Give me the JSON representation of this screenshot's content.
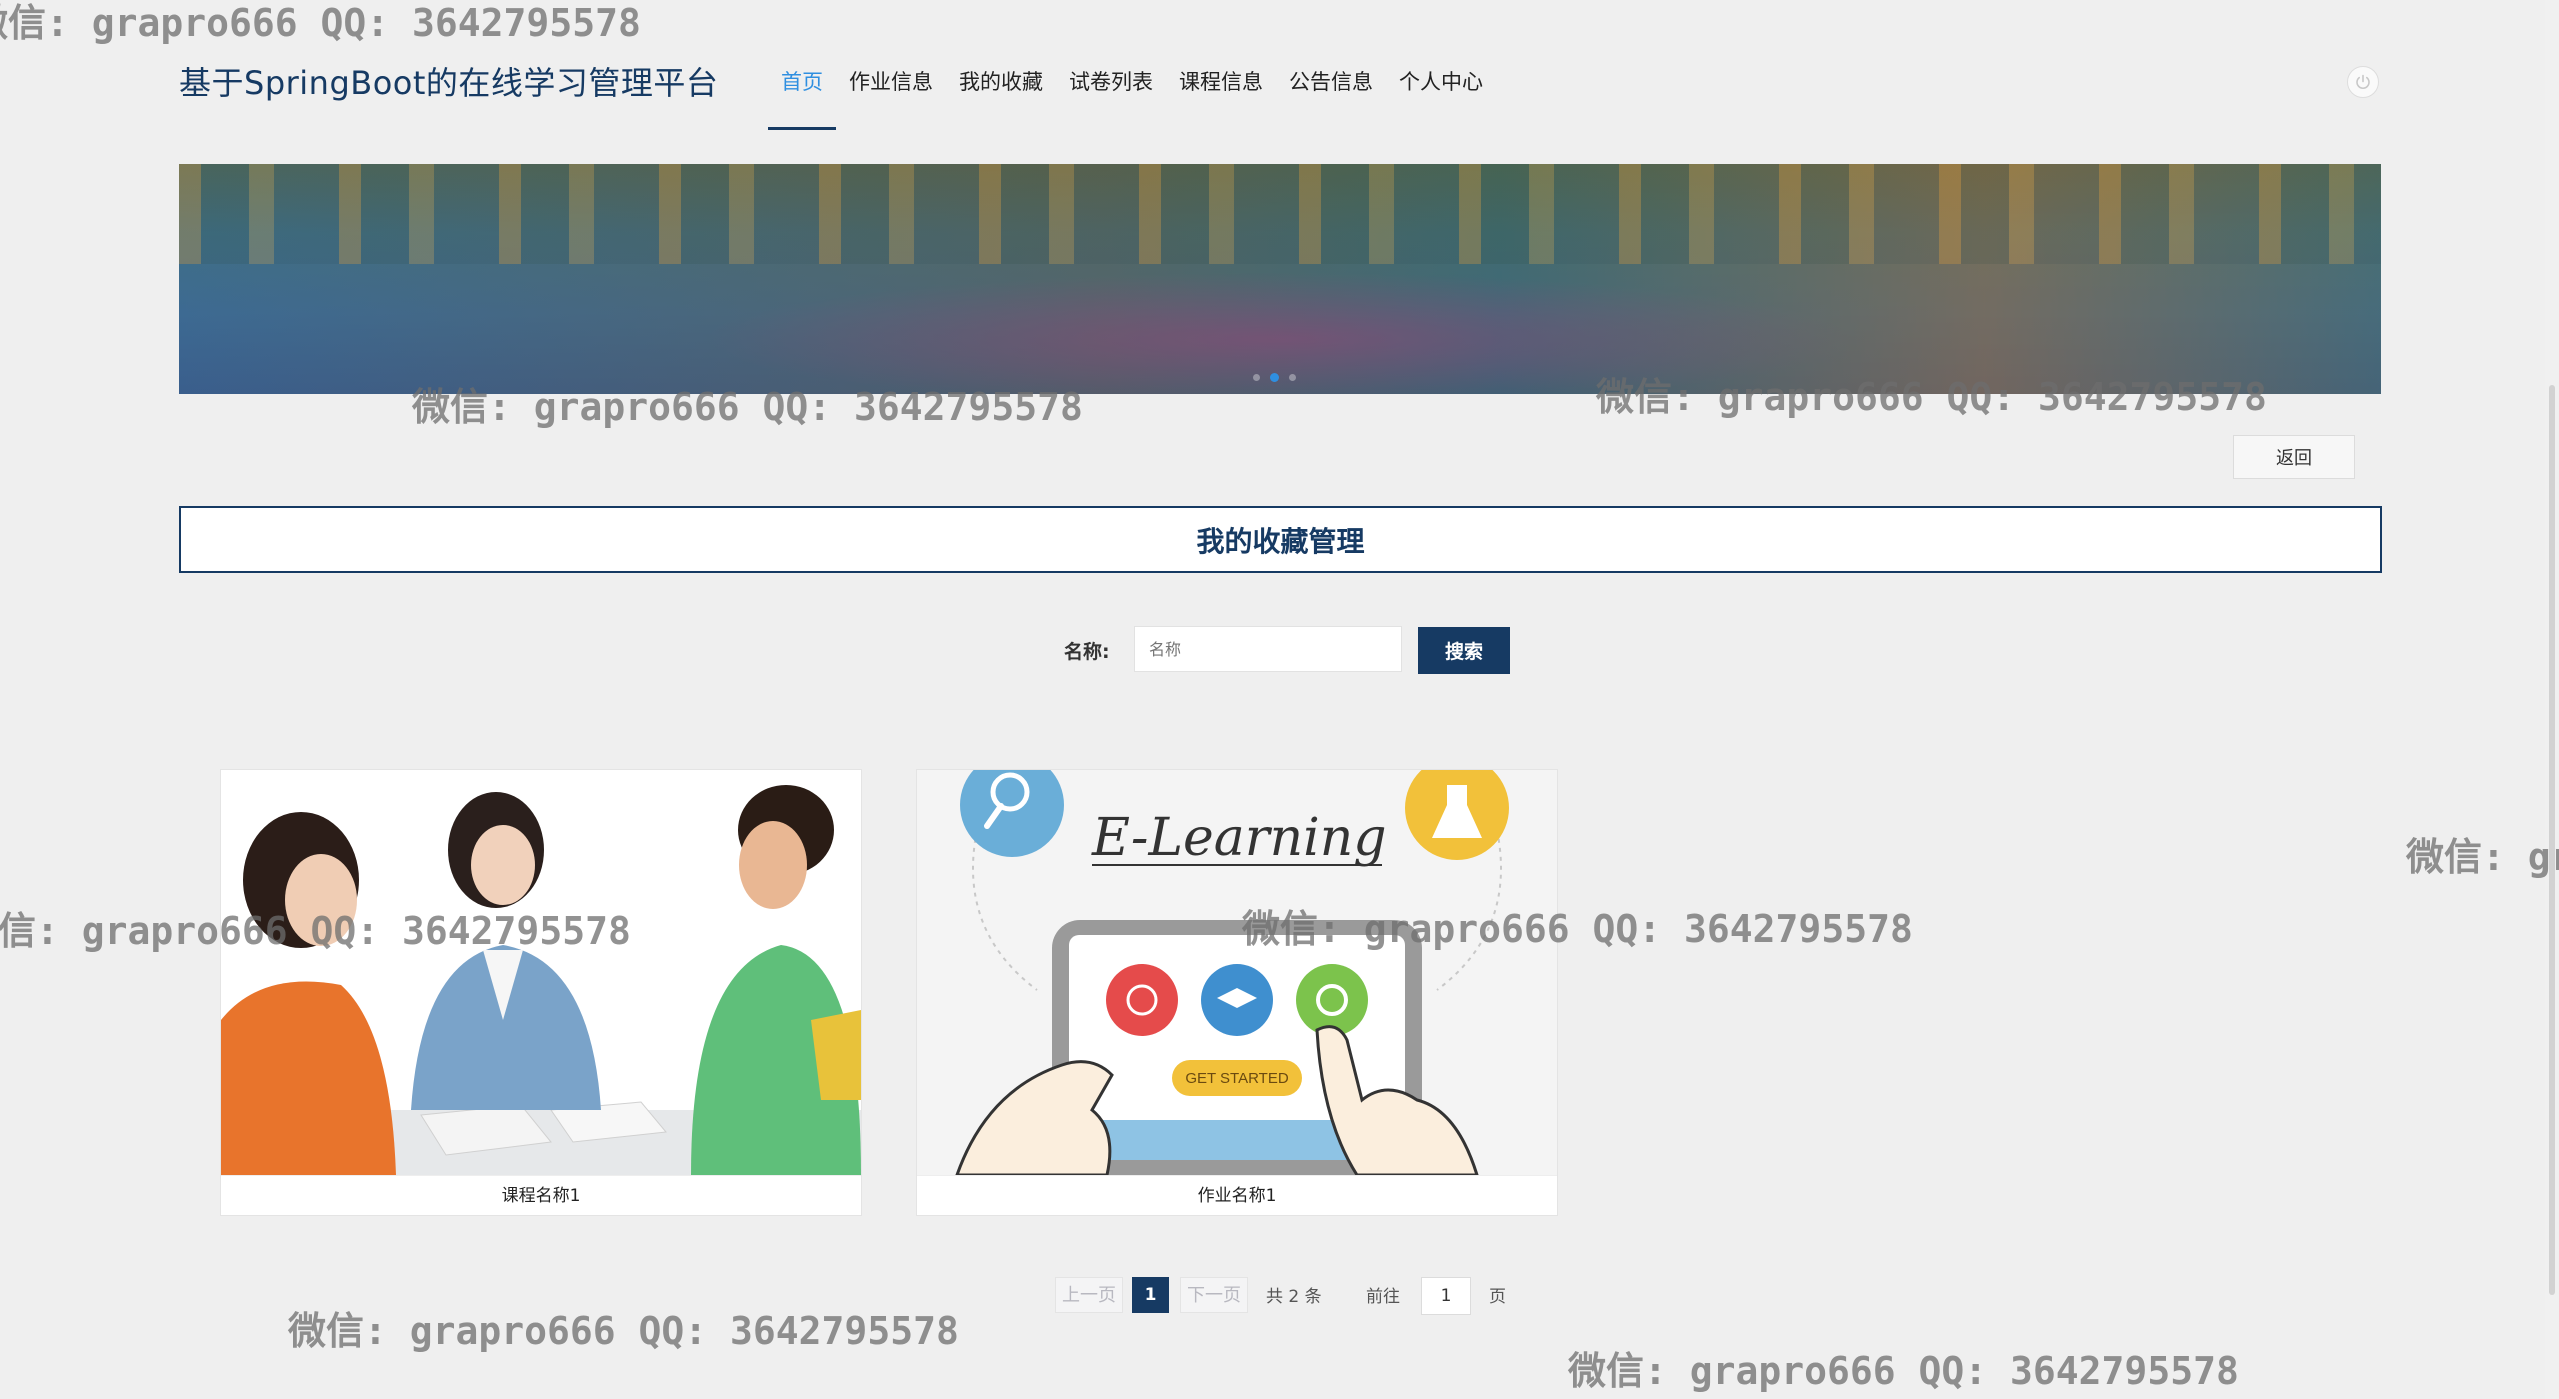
{
  "header": {
    "site_title": "基于SpringBoot的在线学习管理平台",
    "nav": [
      {
        "label": "首页",
        "active": true
      },
      {
        "label": "作业信息"
      },
      {
        "label": "我的收藏"
      },
      {
        "label": "试卷列表"
      },
      {
        "label": "课程信息"
      },
      {
        "label": "公告信息"
      },
      {
        "label": "个人中心"
      }
    ],
    "power_icon": "power-icon"
  },
  "banner": {
    "slide_count": 3,
    "active_slide": 2
  },
  "back_label": "返回",
  "section_title": "我的收藏管理",
  "search": {
    "label": "名称:",
    "placeholder": "名称",
    "value": "",
    "button": "搜索"
  },
  "cards": [
    {
      "caption": "课程名称1",
      "image": "teacher-students-photo"
    },
    {
      "caption": "作业名称1",
      "image": "e-learning-illustration"
    }
  ],
  "illustration": {
    "heading": "E-Learning",
    "button": "GET STARTED"
  },
  "pagination": {
    "prev": "上一页",
    "current_page": "1",
    "next": "下一页",
    "total": "共 2 条",
    "goto_label": "前往",
    "goto_value": "1",
    "page_suffix": "页"
  },
  "watermark": "微信: grapro666 QQ: 3642795578",
  "colors": {
    "primary": "#163a63",
    "accent": "#2f8fe0",
    "background": "#efefef"
  }
}
